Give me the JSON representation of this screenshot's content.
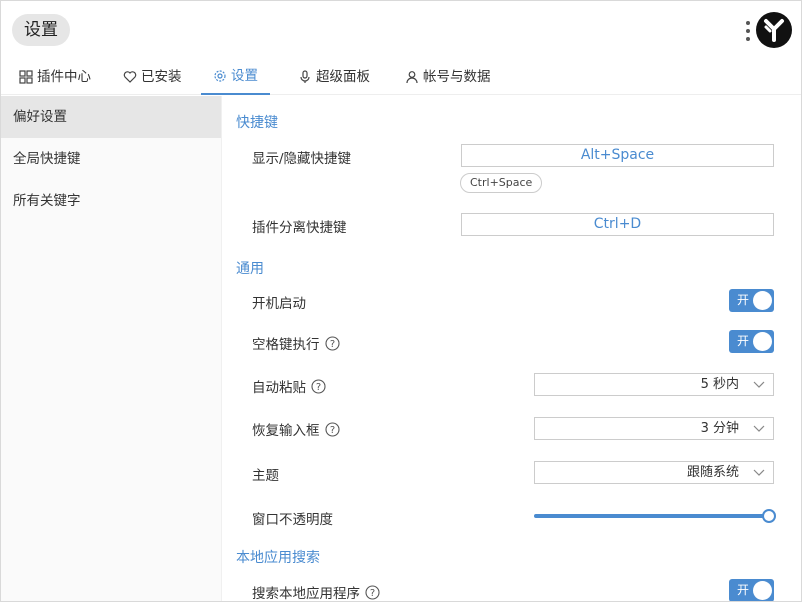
{
  "header": {
    "title": "设置"
  },
  "tabs": [
    {
      "label": "插件中心",
      "icon": "grid-icon"
    },
    {
      "label": "已安装",
      "icon": "heart-icon"
    },
    {
      "label": "设置",
      "icon": "gear-icon",
      "active": true
    },
    {
      "label": "超级面板",
      "icon": "mic-icon"
    },
    {
      "label": "帐号与数据",
      "icon": "user-icon"
    }
  ],
  "sidebar": {
    "items": [
      {
        "label": "偏好设置",
        "active": true
      },
      {
        "label": "全局快捷键"
      },
      {
        "label": "所有关键字"
      }
    ]
  },
  "main": {
    "shortcuts": {
      "title": "快捷键",
      "toggle_label": "显示/隐藏快捷键",
      "toggle_value": "Alt+Space",
      "toggle_chip": "Ctrl+Space",
      "detach_label": "插件分离快捷键",
      "detach_value": "Ctrl+D"
    },
    "general": {
      "title": "通用",
      "autostart_label": "开机启动",
      "autostart_state": "开",
      "space_exec_label": "空格键执行",
      "space_exec_state": "开",
      "autopaste_label": "自动粘贴",
      "autopaste_value": "5 秒内",
      "restore_label": "恢复输入框",
      "restore_value": "3 分钟",
      "theme_label": "主题",
      "theme_value": "跟随系统",
      "opacity_label": "窗口不透明度",
      "opacity_value": 1.0
    },
    "local_search": {
      "title": "本地应用搜索",
      "search_label": "搜索本地应用程序",
      "search_state": "开"
    }
  },
  "colors": {
    "accent": "#4a8bd0",
    "sidebar_active": "#e6e6e6"
  }
}
